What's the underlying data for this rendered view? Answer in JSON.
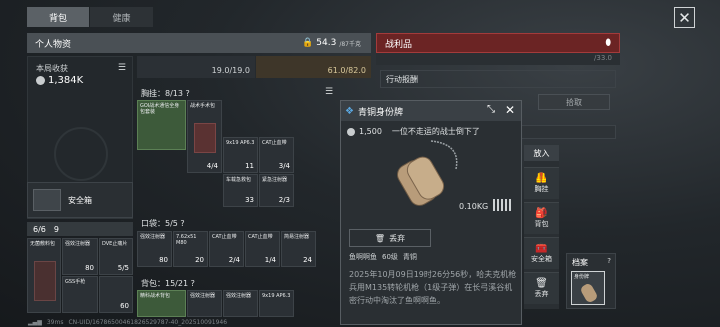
{
  "tabs": {
    "backpack": "背包",
    "health": "健康"
  },
  "personal": {
    "title": "个人物资",
    "weight": "54.3",
    "weight_max": "/87千克"
  },
  "loot": {
    "title": "战利品",
    "action_label": "行动报酬",
    "pickup_button": "拾取",
    "top_value": "/33.0"
  },
  "stats": {
    "income_label": "本局收获",
    "income_value": "1,384K"
  },
  "safe": {
    "label": "安全箱",
    "count": "6/6",
    "count2": "9"
  },
  "durability": {
    "left": "19.0/19.0",
    "right": "61.0/82.0"
  },
  "chest": {
    "label": "胸挂：8/13 ?",
    "items": [
      {
        "name": "GOI战术通信全身包套装",
        "count": ""
      },
      {
        "name": "战术手术包",
        "count": "4/4"
      },
      {
        "name": "9x19 AP6.3",
        "count": "11"
      },
      {
        "name": "CAT止血带",
        "count": "3/4"
      },
      {
        "name": "车载急救包",
        "count": "33"
      },
      {
        "name": "紧急注射器",
        "count": "2/3"
      }
    ]
  },
  "pockets": {
    "label": "口袋：5/5 ?",
    "items": [
      {
        "name": "强效注射器",
        "count": "80"
      },
      {
        "name": "7.62x51 M80",
        "count": "20"
      },
      {
        "name": "CAT止血带",
        "count": "2/4"
      },
      {
        "name": "CAT止血带",
        "count": "1/4"
      },
      {
        "name": "简易注射器",
        "count": "24"
      }
    ]
  },
  "backpack": {
    "label": "背包：15/21 ?",
    "items": [
      {
        "name": "精科战术背包"
      },
      {
        "name": "强效注射器"
      },
      {
        "name": "强效注射器"
      },
      {
        "name": "9x19 AP6.3"
      }
    ]
  },
  "safebox_items": [
    {
      "name": "无菌敷料包",
      "count": ""
    },
    {
      "name": "强效注射器",
      "count": "80"
    },
    {
      "name": "DVE止痛片",
      "count": "5/5"
    },
    {
      "name": "GSS手枪",
      "count": ""
    },
    {
      "name": "强效注射器",
      "count": "60"
    }
  ],
  "modal": {
    "title": "青铜身份牌",
    "price": "1,500",
    "subtitle": "一位不走运的战士倒下了",
    "weight": "0.10KG",
    "discard_button": "丢弃",
    "victim": "鱼啊啊鱼",
    "level": "60级",
    "rank": "青铜",
    "description": "2025年10月09日19时26分56秒，哈夫克机枪兵用M135转轮机枪（1级子弹）在长弓溪谷机密行动中淘汰了鱼啊啊鱼。"
  },
  "side_actions": {
    "put_in": "放入",
    "chest": "胸挂",
    "backpack": "背包",
    "safebox": "安全箱",
    "discard": "丢弃"
  },
  "archive": {
    "label": "档案",
    "slot_label": "身份牌"
  },
  "status_bar": {
    "ping": "39ms",
    "uid": "CN-UID/16786500461826529787-40_202510091946"
  },
  "icons": [
    "close-icon",
    "lock-icon",
    "weight-icon",
    "list-icon",
    "coin-icon",
    "vest-icon",
    "bag-icon",
    "safe-icon",
    "trash-icon",
    "collapse-icon",
    "share-icon"
  ]
}
